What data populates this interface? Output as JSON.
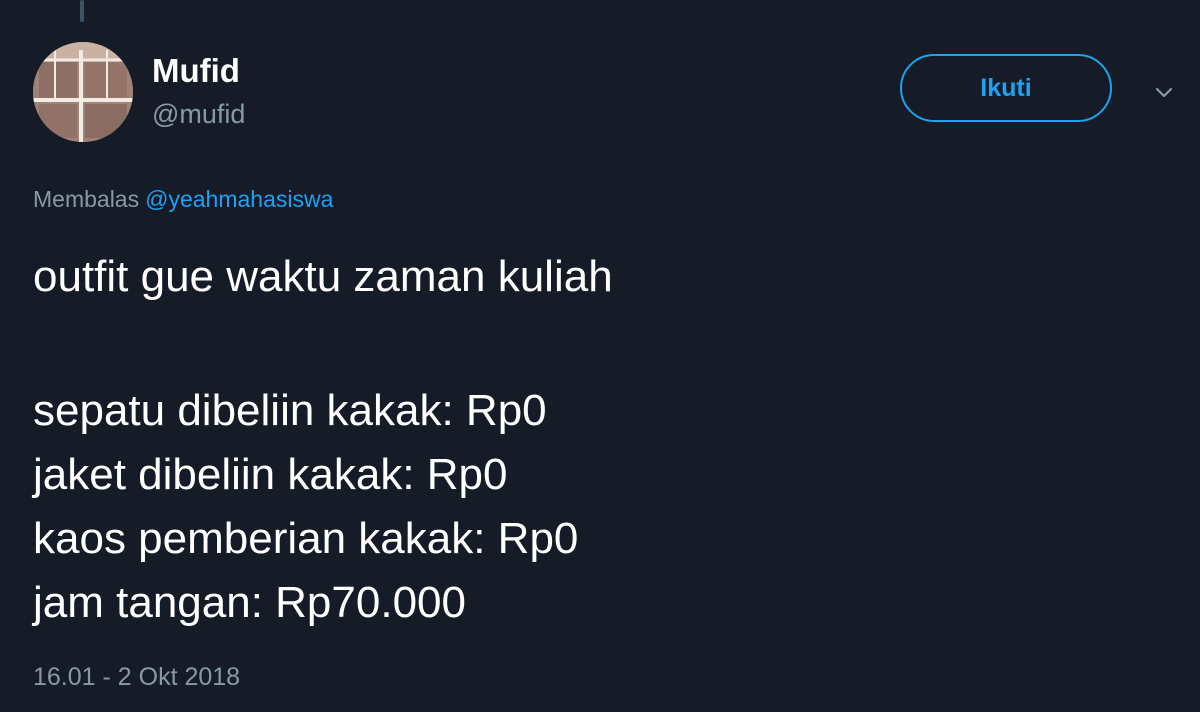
{
  "author": {
    "display_name": "Mufid",
    "handle": "@mufid",
    "avatar_icon": "avatar-photo"
  },
  "actions": {
    "follow_label": "Ikuti",
    "menu_icon": "chevron-down-icon"
  },
  "reply": {
    "prefix": "Membalas",
    "to": "@yeahmahasiswa"
  },
  "tweet": {
    "lines": [
      "outfit gue waktu zaman kuliah",
      "",
      "sepatu dibeliin kakak: Rp0",
      "jaket dibeliin kakak: Rp0",
      "kaos pemberian kakak: Rp0",
      "jam tangan: Rp70.000"
    ],
    "timestamp": "16.01 - 2 Okt 2018"
  },
  "colors": {
    "background": "#151c27",
    "accent": "#1da1f2",
    "muted": "#8899a6",
    "text": "#ffffff"
  }
}
